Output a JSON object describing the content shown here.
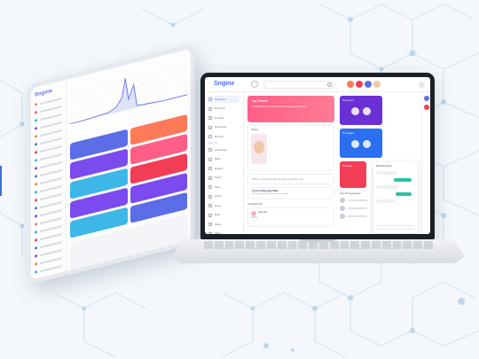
{
  "app": {
    "brand": "Sngine",
    "banner_title": "Say Thanks",
    "banner_text": "Send a thank you to someone who helped you this year",
    "stories_label": "Stories",
    "composer_placeholder": "What's on your mind? Say something, guest/hero, user",
    "alert_title": "Good looking App Sales",
    "alert_text": "We'll help you get started on your wedding",
    "threaded_label": "Threaded Post",
    "post_user": "Jane Doe",
    "post_text": "Darling",
    "chat_title": "Recently Active",
    "friends_label": "Friends Suggestions",
    "profile_tiles": [
      {
        "title": "Top Users",
        "color": "#6b2fd6"
      },
      {
        "title": "Top Pages",
        "color": "#2b6ff3"
      },
      {
        "title": "Trending",
        "color": "#f23d56"
      }
    ],
    "sidebar": [
      {
        "label": "News Feed",
        "active": true
      },
      {
        "label": "My Friends"
      },
      {
        "label": "My Pages"
      },
      {
        "label": "Saved Posts"
      },
      {
        "label": "Memories"
      },
      {
        "label": "Ads Manager"
      },
      {
        "label": "Wallet"
      },
      {
        "label": "Boosted"
      },
      {
        "label": "People"
      },
      {
        "label": "Pages"
      },
      {
        "label": "Groups"
      },
      {
        "label": "Events"
      },
      {
        "label": "Blogs"
      },
      {
        "label": "Market"
      },
      {
        "label": "Offers"
      },
      {
        "label": "Jobs"
      },
      {
        "label": "Forums"
      },
      {
        "label": "Movies"
      },
      {
        "label": "Games"
      },
      {
        "label": "Developers"
      }
    ],
    "sidebar_section": "EXPLORE"
  },
  "tablet": {
    "brand": "Sngine",
    "cards": [
      "#5b6ee8",
      "#ff7a59",
      "#7b4bf0",
      "#ff5e86",
      "#3db7e8",
      "#f23d56",
      "#7b4bf0",
      "#7b4bf0",
      "#3db7e8",
      "#5b6ee8"
    ],
    "nav_dots": [
      "#ff7a59",
      "#ff5e86",
      "#3db7e8",
      "#7b4bf0",
      "#ff7a59",
      "#5b6ee8",
      "#f23d56",
      "#3db7e8",
      "#7b4bf0",
      "#5b6ee8",
      "#ff7a59",
      "#3db7e8",
      "#f23d56",
      "#5b6ee8",
      "#7b4bf0",
      "#ff7a59",
      "#3db7e8",
      "#f23d56",
      "#5b6ee8",
      "#7b4bf0",
      "#ff7a59",
      "#3db7e8"
    ]
  },
  "colors": {
    "accent": "#4a6cf7",
    "hex_lines": "#cfe0f2"
  }
}
